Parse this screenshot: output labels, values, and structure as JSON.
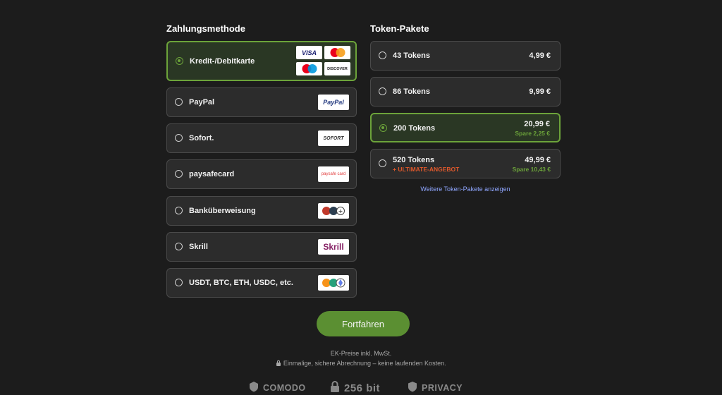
{
  "payment": {
    "title": "Zahlungsmethode",
    "methods": [
      {
        "label": "Kredit-/Debitkarte",
        "logos": [
          "VISA",
          "mastercard",
          "maestro",
          "DISCOVER"
        ]
      },
      {
        "label": "PayPal",
        "logo": "PayPal"
      },
      {
        "label": "Sofort.",
        "logo": "SOFORT"
      },
      {
        "label": "paysafecard",
        "logo": "paysafe card"
      },
      {
        "label": "Banküberweisung",
        "logo": "bank-transfer"
      },
      {
        "label": "Skrill",
        "logo": "Skrill"
      },
      {
        "label": "USDT, BTC, ETH, USDC, etc.",
        "logo": "crypto"
      }
    ]
  },
  "tokens": {
    "title": "Token-Pakete",
    "packages": [
      {
        "label": "43 Tokens",
        "price": "4,99 €"
      },
      {
        "label": "86 Tokens",
        "price": "9,99 €"
      },
      {
        "label": "200 Tokens",
        "price": "20,99 €",
        "save": "Spare 2,25 €"
      },
      {
        "label": "520 Tokens",
        "price": "49,99 €",
        "save": "Spare 10,43 €",
        "promo": "+ ULTIMATE-ANGEBOT"
      }
    ],
    "more_link": "Weitere Token-Pakete anzeigen"
  },
  "continue_button": "Fortfahren",
  "footer": {
    "line1": "EK-Preise inkl. MwSt.",
    "line2": "Einmalige, sichere Abrechnung – keine laufenden Kosten.",
    "badges": [
      "COMODO",
      "256 bit",
      "PRIVACY"
    ]
  },
  "colors": {
    "accent": "#6ca33a",
    "button": "#5b8f32",
    "promo": "#e2592b",
    "link": "#8fa6ff"
  }
}
